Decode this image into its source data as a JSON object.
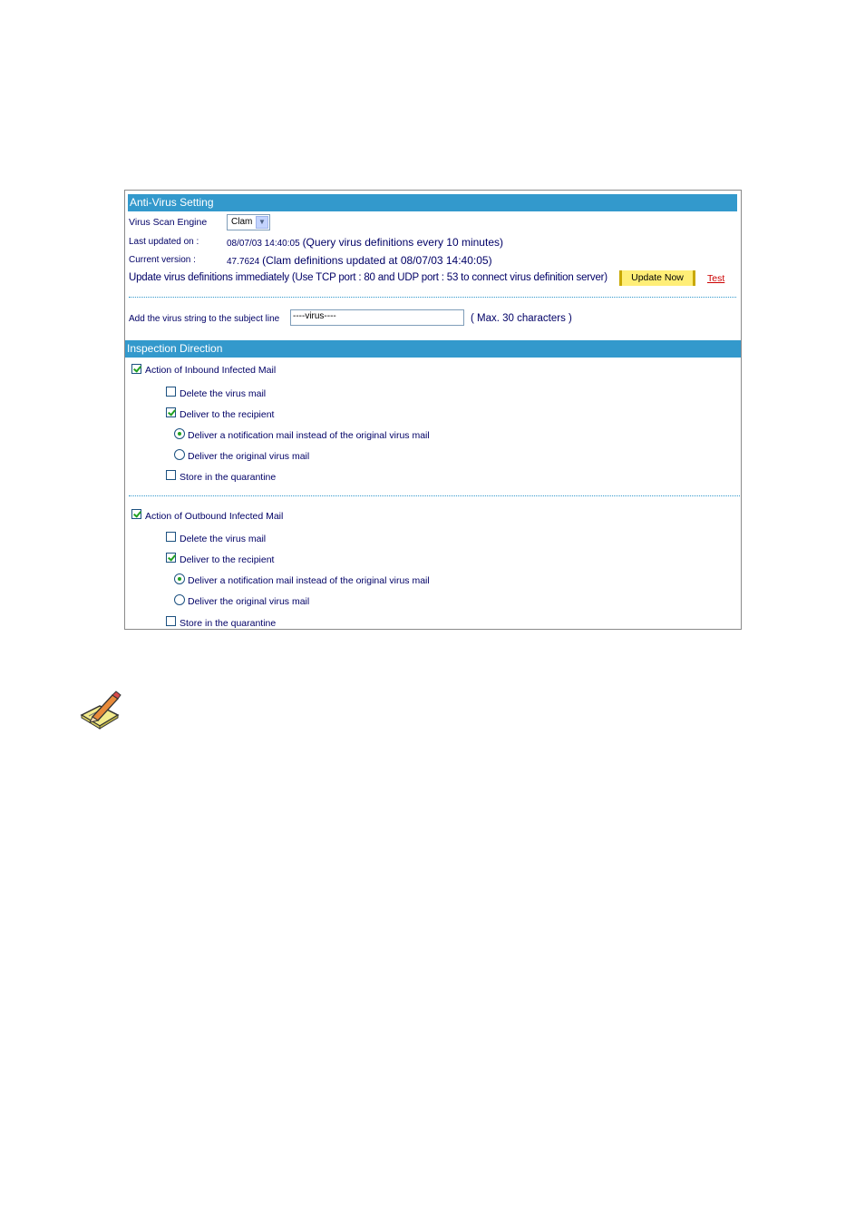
{
  "panel": {
    "title": "Anti-Virus Setting",
    "engine_label": "Virus Scan Engine",
    "engine_value": "Clam",
    "last_updated_label": "Last updated on :",
    "last_updated_value": "08/07/03 14:40:05",
    "last_updated_note": "(Query virus definitions every 10 minutes)",
    "current_version_label": "Current version :",
    "current_version_value": "47.7624",
    "current_version_note": "(Clam definitions updated at 08/07/03 14:40:05)",
    "update_text": "Update virus definitions immediately (Use TCP port : 80 and UDP port : 53 to connect virus definition server)",
    "update_button": "Update Now",
    "test_link": "Test",
    "subject_label": "Add the virus string to the subject line",
    "subject_value": "----virus----",
    "subject_hint": "( Max. 30 characters )"
  },
  "inspection": {
    "title": "Inspection Direction",
    "inbound": {
      "label": "Action of Inbound Infected Mail",
      "checked": true,
      "delete": "Delete the virus mail",
      "deliver": "Deliver to the recipient",
      "notify": "Deliver a notification mail instead of the original virus mail",
      "original": "Deliver the original virus mail",
      "quarantine": "Store in the quarantine"
    },
    "outbound": {
      "label": "Action of Outbound Infected Mail",
      "checked": true,
      "delete": "Delete the virus mail",
      "deliver": "Deliver to the recipient",
      "notify": "Deliver a notification mail instead of the original virus mail",
      "original": "Deliver the original virus mail",
      "quarantine": "Store in the quarantine"
    }
  },
  "icons": {
    "note": "note-pencil-icon"
  }
}
